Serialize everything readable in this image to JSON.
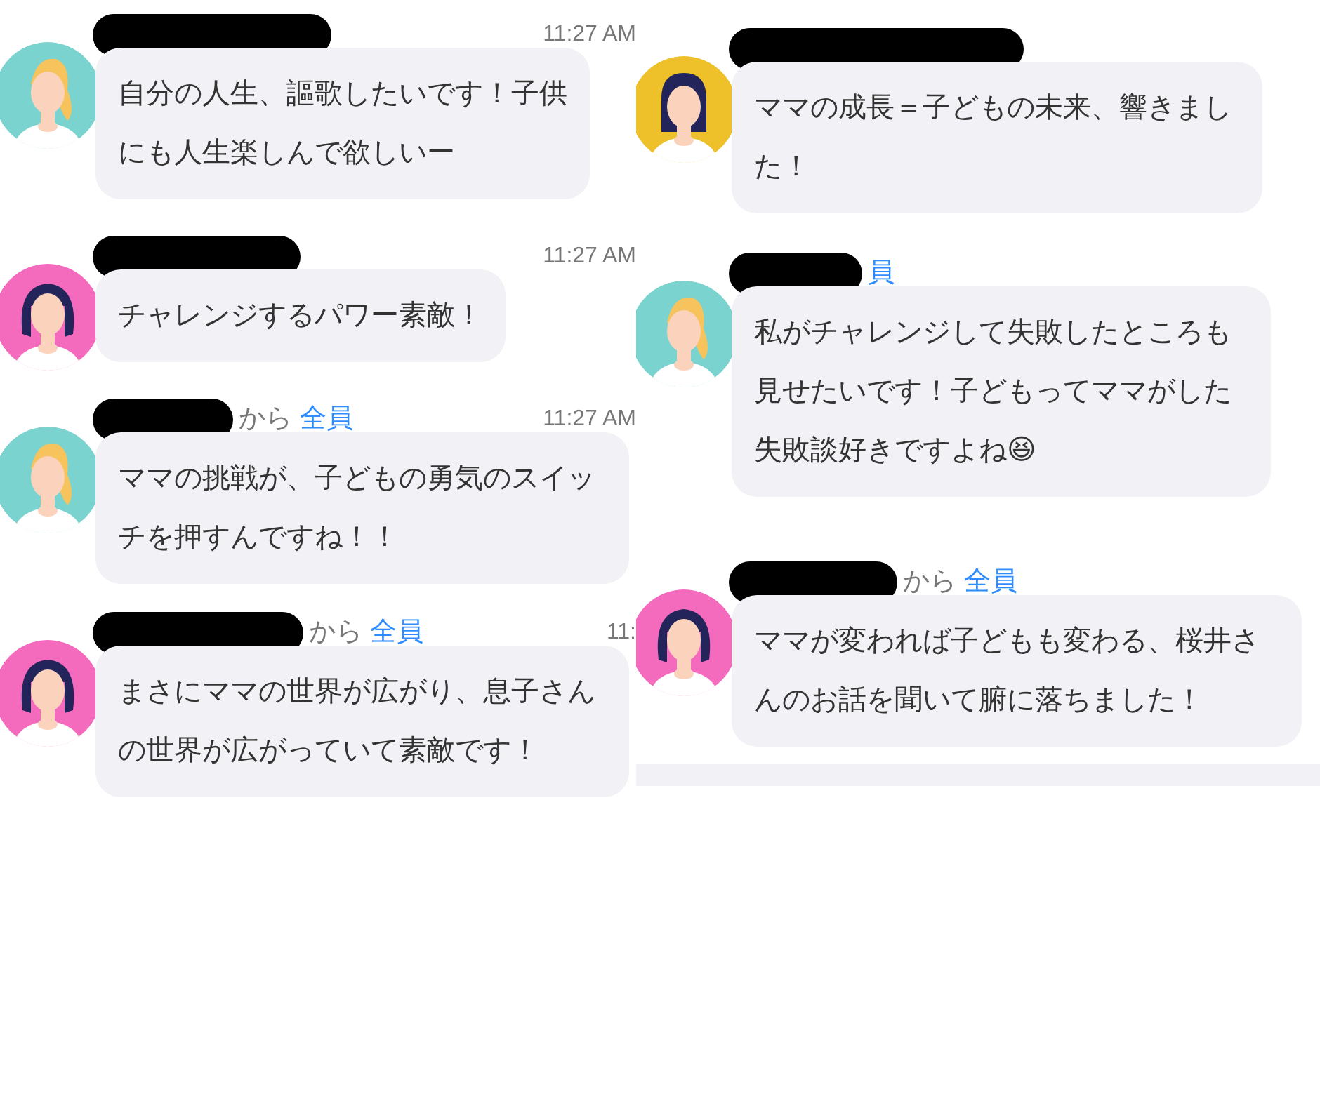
{
  "columns": [
    {
      "messages": [
        {
          "time": "11:27 AM",
          "avatar": {
            "color": "#7ad3cf",
            "kind": "blonde"
          },
          "text": "自分の人生、謳歌したいです！子供にも人生楽しんで欲しいー"
        },
        {
          "time": "11:27 AM",
          "avatar": {
            "color": "#f46bbd",
            "kind": "dark"
          },
          "text": "チャレンジするパワー素敵！"
        },
        {
          "from": "から",
          "to": "全員",
          "time": "11:27 AM",
          "avatar": {
            "color": "#7ad3cf",
            "kind": "blonde"
          },
          "text": "ママの挑戦が、子どもの勇気のスイッチを押すんですね！！"
        },
        {
          "from": "から",
          "to": "全員",
          "time": "11:",
          "avatar": {
            "color": "#f46bbd",
            "kind": "dark"
          },
          "text": "まさにママの世界が広がり、息子さんの世界が広がっていて素敵です！"
        }
      ]
    },
    {
      "messages": [
        {
          "avatar": {
            "color": "#eec12a",
            "kind": "straight"
          },
          "text": "ママの成長＝子どもの未来、響きました！"
        },
        {
          "to": "員",
          "avatar": {
            "color": "#7ad3cf",
            "kind": "blonde"
          },
          "text": "私がチャレンジして失敗したところも見せたいです！子どもってママがした失敗談好きですよね😆"
        },
        {
          "from": "から",
          "to": "全員",
          "avatar": {
            "color": "#f46bbd",
            "kind": "dark"
          },
          "text": "ママが変われば子どもも変わる、桜井さんのお話を聞いて腑に落ちました！"
        }
      ]
    }
  ]
}
